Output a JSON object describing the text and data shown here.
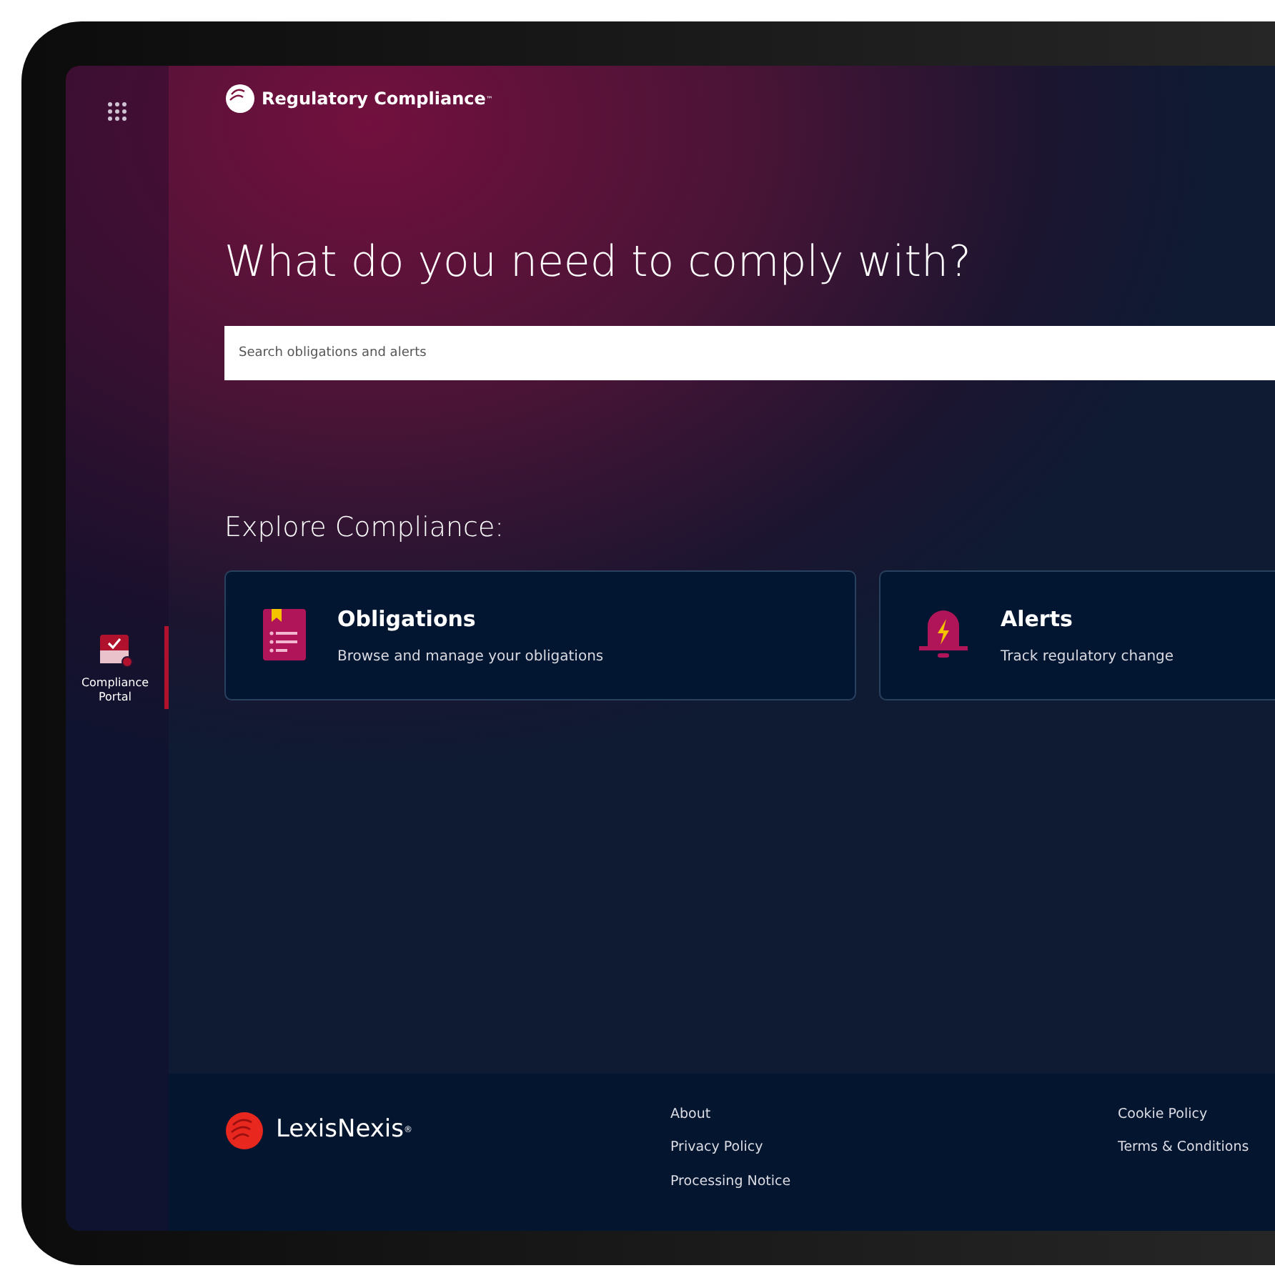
{
  "sidebar": {
    "items": [
      {
        "label": "Compliance Portal",
        "selected": true
      }
    ]
  },
  "header": {
    "product_name": "Regulatory Compliance",
    "trademark": "™"
  },
  "hero": {
    "heading": "What do you need to comply with?",
    "search": {
      "placeholder": "Search obligations and alerts"
    }
  },
  "explore": {
    "heading": "Explore Compliance:",
    "cards": [
      {
        "kind": "book",
        "title": "Obligations",
        "description": "Browse and manage your obligations"
      },
      {
        "kind": "bell",
        "title": "Alerts",
        "description": "Track regulatory change"
      }
    ]
  },
  "footer": {
    "brand": "LexisNexis",
    "brand_mark": "®",
    "links_1": [
      "About",
      "Privacy Policy",
      "Processing Notice"
    ],
    "links_2": [
      "Cookie Policy",
      "Terms & Conditions"
    ]
  }
}
